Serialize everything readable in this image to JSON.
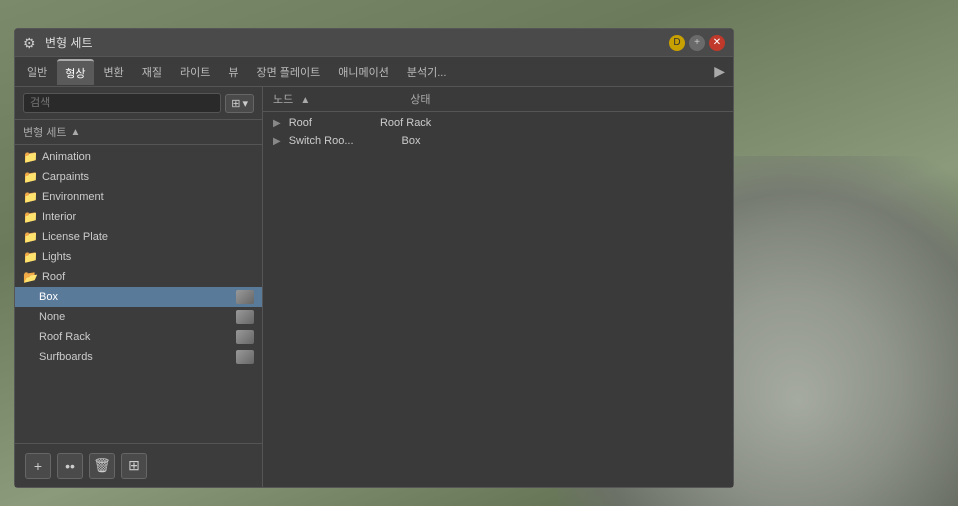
{
  "window": {
    "title": "변형 세트",
    "title_icon": "⚙"
  },
  "title_buttons": {
    "gold_label": "D",
    "plus_label": "+",
    "close_label": "✕"
  },
  "tabs": [
    {
      "id": "general",
      "label": "일반"
    },
    {
      "id": "shape",
      "label": "형상",
      "active": true
    },
    {
      "id": "transform",
      "label": "변환"
    },
    {
      "id": "material",
      "label": "재질"
    },
    {
      "id": "light",
      "label": "라이트"
    },
    {
      "id": "view",
      "label": "뷰"
    },
    {
      "id": "scene",
      "label": "장면 플레이트"
    },
    {
      "id": "animation",
      "label": "애니메이션"
    },
    {
      "id": "analysis",
      "label": "분석기..."
    }
  ],
  "left_panel": {
    "search_placeholder": "검색",
    "filter_icon": "⊞",
    "filter_arrow": "▾",
    "tree_header_label": "변형 세트",
    "sort_arrow": "▲"
  },
  "tree_items": [
    {
      "id": "animation",
      "label": "Animation",
      "type": "folder",
      "indent": 0
    },
    {
      "id": "carpaints",
      "label": "Carpaints",
      "type": "folder",
      "indent": 0
    },
    {
      "id": "environment",
      "label": "Environment",
      "type": "folder",
      "indent": 0
    },
    {
      "id": "interior",
      "label": "Interior",
      "type": "folder",
      "indent": 0
    },
    {
      "id": "licenseplate",
      "label": "License Plate",
      "type": "folder",
      "indent": 0
    },
    {
      "id": "lights",
      "label": "Lights",
      "type": "folder",
      "indent": 0
    },
    {
      "id": "roof",
      "label": "Roof",
      "type": "folder-open",
      "indent": 0
    },
    {
      "id": "box",
      "label": "Box",
      "type": "item",
      "indent": 1,
      "selected": true,
      "has_thumb": true
    },
    {
      "id": "none",
      "label": "None",
      "type": "item",
      "indent": 1,
      "selected": false,
      "has_thumb": true
    },
    {
      "id": "roofRack",
      "label": "Roof Rack",
      "type": "item",
      "indent": 1,
      "selected": false,
      "has_thumb": true
    },
    {
      "id": "surfboards",
      "label": "Surfboards",
      "type": "item",
      "indent": 1,
      "selected": false,
      "has_thumb": true
    }
  ],
  "right_panel": {
    "col_node": "노드",
    "col_status": "상태",
    "sort_arrow": "▲"
  },
  "right_items": [
    {
      "id": "roof",
      "label": "Roof",
      "status": "Roof Rack",
      "expanded": false
    },
    {
      "id": "switchRoof",
      "label": "Switch Roo...",
      "status": "Box",
      "expanded": false
    }
  ],
  "toolbar": {
    "add_label": "+",
    "dots_label": "••",
    "delete_label": "🗑",
    "grid_label": "⊞"
  }
}
